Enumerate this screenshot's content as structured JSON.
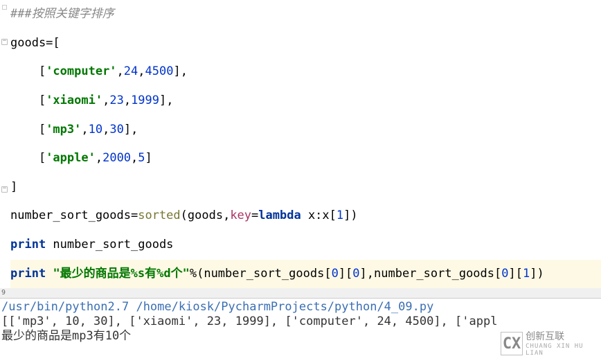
{
  "code": {
    "comment": "###按照关键字排序",
    "goods_open": "goods=[",
    "row1_indent": "    [",
    "row1_s": "'computer'",
    "row1_c1": ",",
    "row1_n1": "24",
    "row1_c2": ",",
    "row1_n2": "4500",
    "row1_end": "],",
    "row2_s": "'xiaomi'",
    "row2_n1": "23",
    "row2_n2": "1999",
    "row2_end": "],",
    "row3_s": "'mp3'",
    "row3_n1": "10",
    "row3_n2": "30",
    "row3_end": "],",
    "row4_s": "'apple'",
    "row4_n1": "2000",
    "row4_n2": "5",
    "row4_end": "]",
    "goods_close": "]",
    "sorted_lhs": "number_sort_goods=",
    "sorted_fn": "sorted",
    "sorted_open": "(goods,",
    "sorted_key": "key",
    "sorted_eq": "=",
    "sorted_lambda": "lambda",
    "sorted_expr_a": " x:x[",
    "sorted_idx": "1",
    "sorted_expr_b": "])",
    "print_kw": "print",
    "print1_rest": " number_sort_goods",
    "print2_str": "\"最少的商品是%s有%d个\"",
    "print2_mid_a": "%(number_sort_goods[",
    "print2_idx0a": "0",
    "print2_mid_b": "][",
    "print2_idx0b": "0",
    "print2_mid_c": "],number_sort_goods[",
    "print2_idx0c": "0",
    "print2_mid_d": "][",
    "print2_idx1": "1",
    "print2_mid_e": "])"
  },
  "status_bar": "9",
  "output": {
    "path": "/usr/bin/python2.7 /home/kiosk/PycharmProjects/python/4_09.py",
    "line1": "[['mp3', 10, 30], ['xiaomi', 23, 1999], ['computer', 24, 4500], ['appl",
    "line2": "最少的商品是mp3有10个"
  },
  "watermark": {
    "logo": "CX",
    "brand": "创新互联",
    "sub": "CHUANG XIN HU LIAN"
  }
}
